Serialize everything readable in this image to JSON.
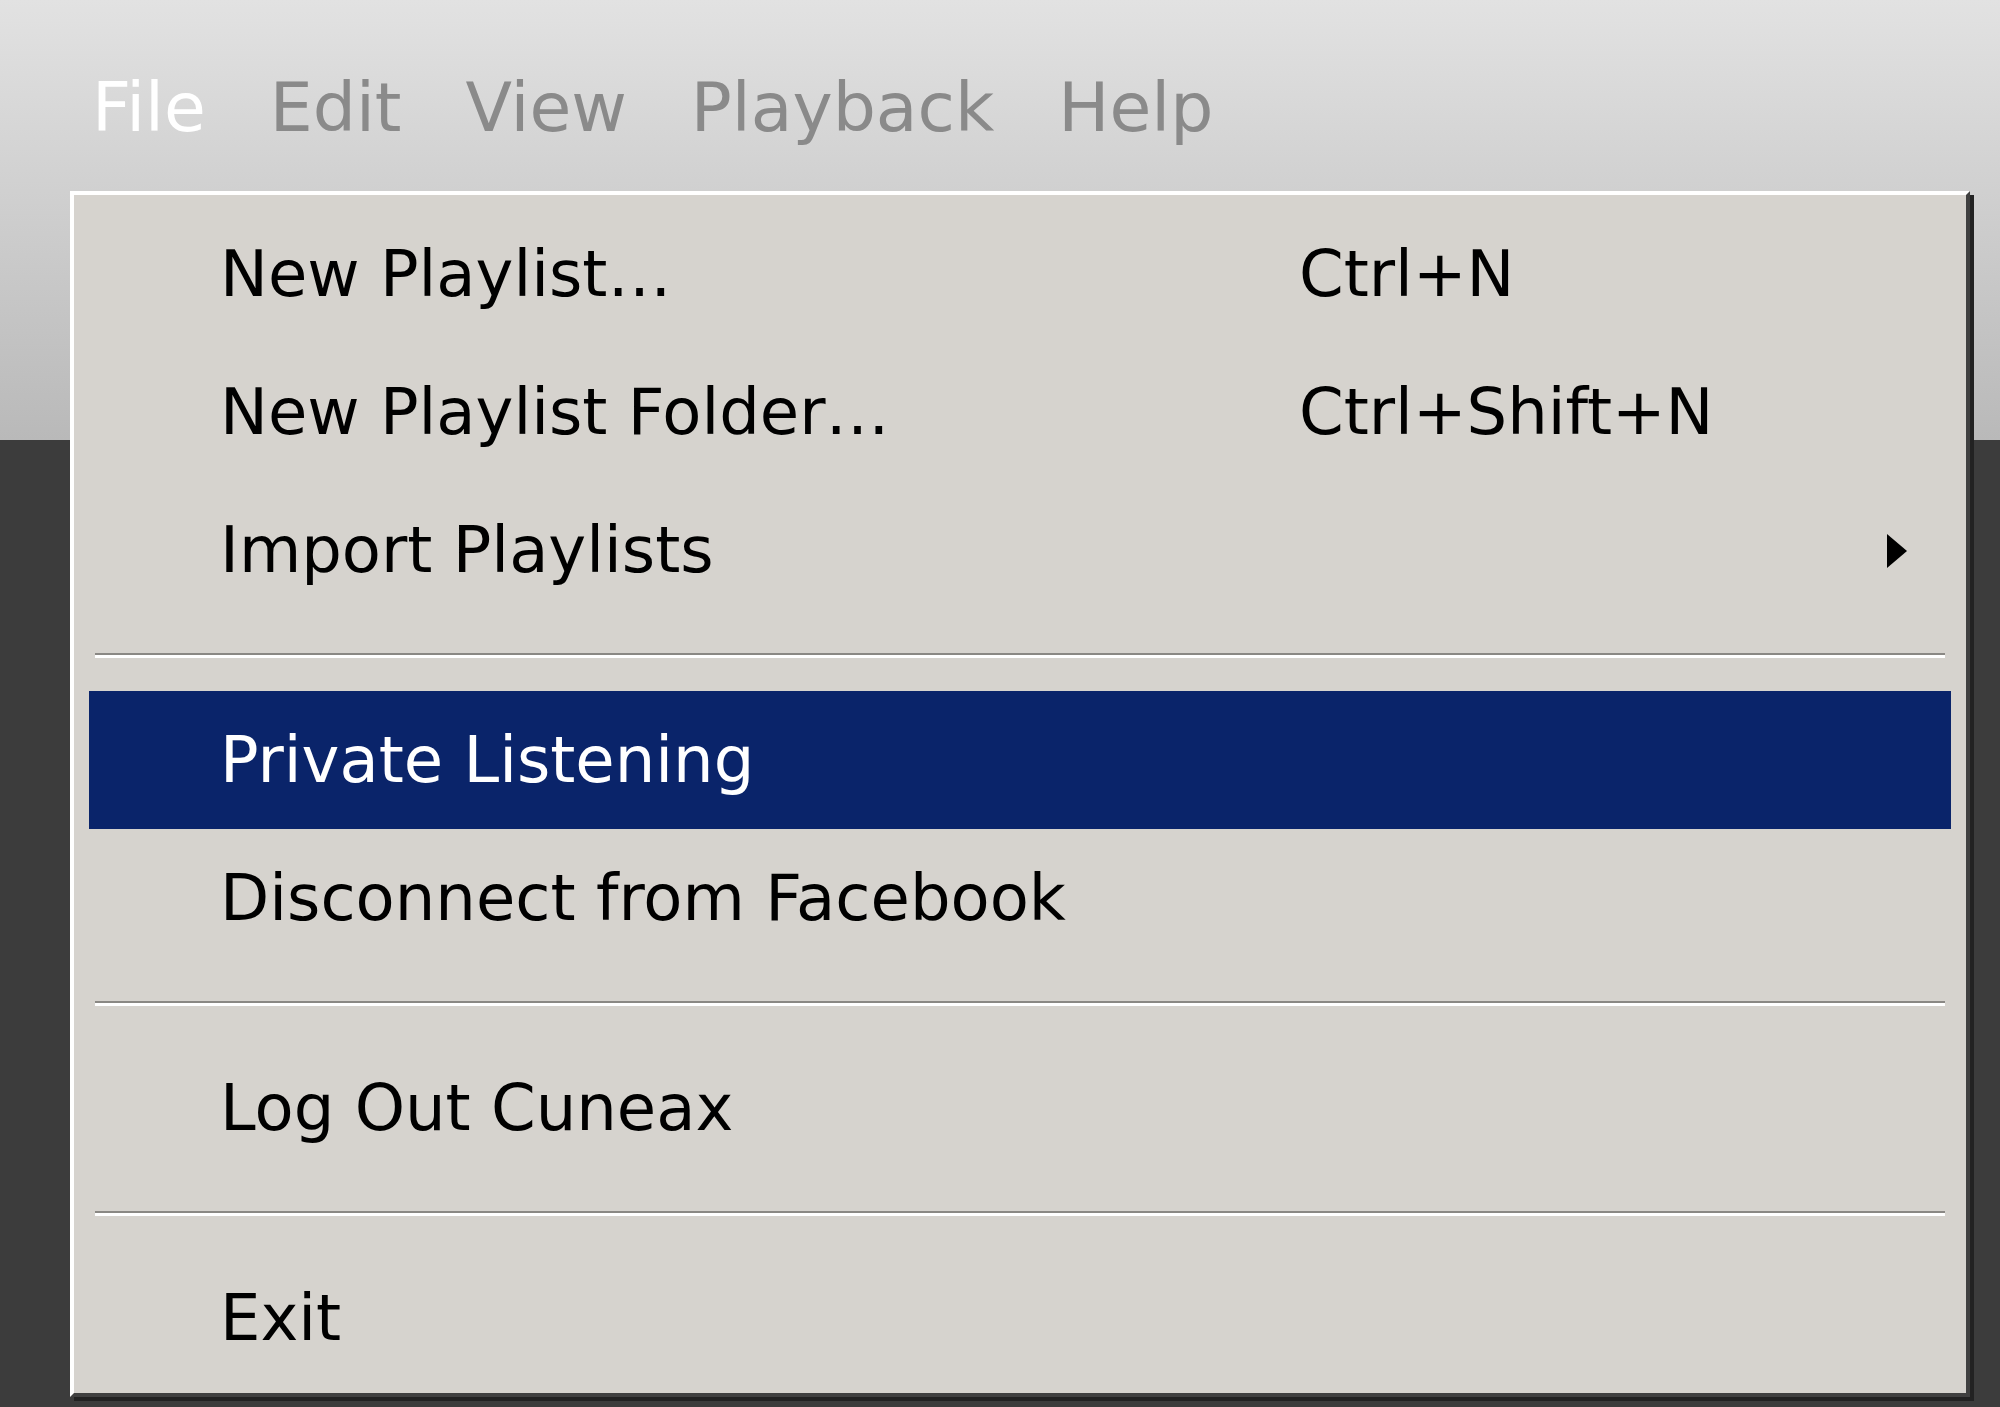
{
  "menu_bar": [
    {
      "label": "File",
      "selected": true
    },
    {
      "label": "Edit",
      "selected": false
    },
    {
      "label": "View",
      "selected": false
    },
    {
      "label": "Playback",
      "selected": false
    },
    {
      "label": "Help",
      "selected": false
    }
  ],
  "menu": {
    "items": [
      {
        "kind": "item",
        "label": "New Playlist…",
        "shortcut": "Ctrl+N",
        "submenu": false,
        "selected": false
      },
      {
        "kind": "item",
        "label": "New Playlist Folder…",
        "shortcut": "Ctrl+Shift+N",
        "submenu": false,
        "selected": false
      },
      {
        "kind": "item",
        "label": "Import Playlists",
        "submenu": true,
        "selected": false
      },
      {
        "kind": "separator"
      },
      {
        "kind": "item",
        "label": "Private Listening",
        "submenu": false,
        "selected": true
      },
      {
        "kind": "item",
        "label": "Disconnect from Facebook",
        "submenu": false,
        "selected": false
      },
      {
        "kind": "separator"
      },
      {
        "kind": "item",
        "label": "Log Out Cuneax",
        "submenu": false,
        "selected": false
      },
      {
        "kind": "separator"
      },
      {
        "kind": "item",
        "label": "Exit",
        "submenu": false,
        "selected": false
      }
    ]
  }
}
